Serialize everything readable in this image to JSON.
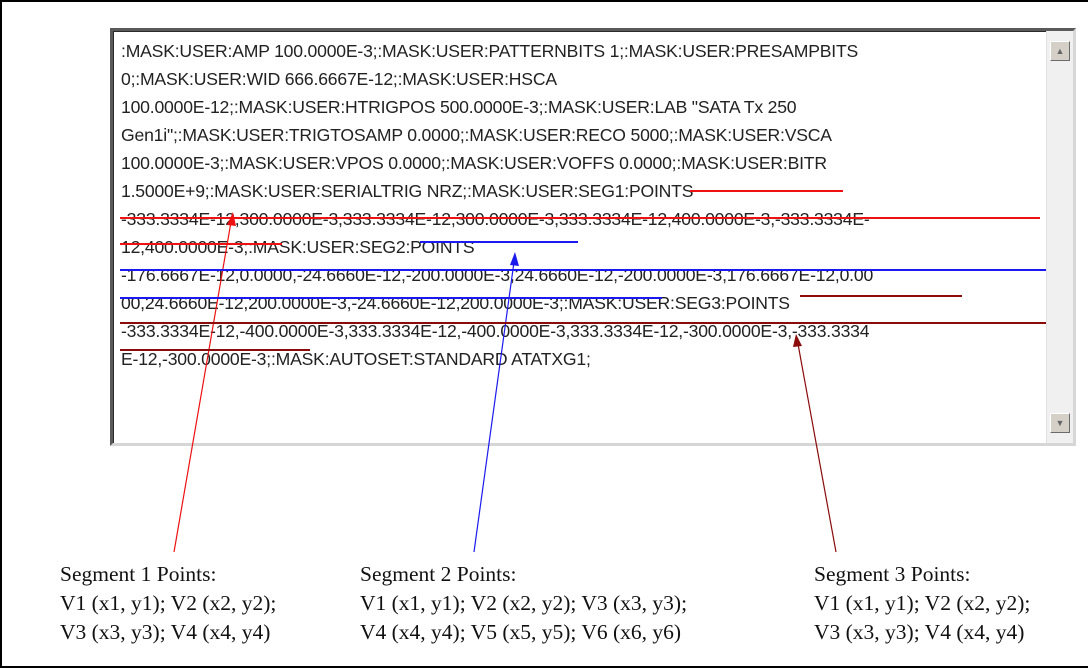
{
  "textbox": {
    "lines": [
      ":MASK:USER:AMP 100.0000E-3;:MASK:USER:PATTERNBITS 1;:MASK:USER:PRESAMPBITS",
      "0;:MASK:USER:WID 666.6667E-12;:MASK:USER:HSCA",
      "100.0000E-12;:MASK:USER:HTRIGPOS 500.0000E-3;:MASK:USER:LAB \"SATA Tx 250",
      "Gen1i\";:MASK:USER:TRIGTOSAMP 0.0000;:MASK:USER:RECO 5000;:MASK:USER:VSCA",
      "100.0000E-3;:MASK:USER:VPOS 0.0000;:MASK:USER:VOFFS 0.0000;:MASK:USER:BITR",
      "1.5000E+9;:MASK:USER:SERIALTRIG NRZ;:MASK:USER:SEG1:POINTS",
      "-333.3334E-12,300.0000E-3,333.3334E-12,300.0000E-3,333.3334E-12,400.0000E-3,-333.3334E-",
      "12,400.0000E-3;:MASK:USER:SEG2:POINTS",
      "-176.6667E-12,0.0000,-24.6660E-12,-200.0000E-3,24.6660E-12,-200.0000E-3,176.6667E-12,0.00",
      "00,24.6660E-12,200.0000E-3,-24.6660E-12,200.0000E-3;:MASK:USER:SEG3:POINTS",
      "-333.3334E-12,-400.0000E-3,333.3334E-12,-400.0000E-3,333.3334E-12,-300.0000E-3,-333.3334",
      "E-12,-300.0000E-3;:MASK:AUTOSET:STANDARD ATATXG1;"
    ]
  },
  "scrollbar": {
    "up_icon": "scroll-up-arrow",
    "down_icon": "scroll-down-arrow",
    "up_glyph": "▲",
    "down_glyph": "▼"
  },
  "captions": [
    {
      "title": "Segment 1 Points:",
      "line1": "V1 (x1, y1); V2 (x2, y2);",
      "line2": "V3 (x3, y3); V4 (x4, y4)"
    },
    {
      "title": "Segment 2 Points:",
      "line1": "V1 (x1, y1); V2 (x2, y2); V3 (x3, y3);",
      "line2": "V4 (x4, y4); V5 (x5, y5); V6 (x6, y6)"
    },
    {
      "title": "Segment 3 Points:",
      "line1": "V1 (x1, y1); V2 (x2, y2);",
      "line2": "V3 (x3, y3); V4 (x4, y4)"
    }
  ],
  "colors": {
    "segment1": "#ee1111",
    "segment2": "#1a1aee",
    "segment3": "#8b0a0a"
  }
}
